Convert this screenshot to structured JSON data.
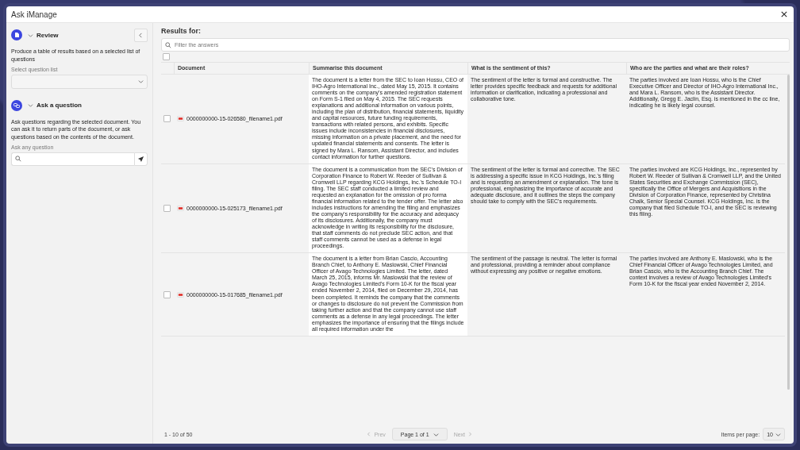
{
  "window": {
    "title": "Ask iManage"
  },
  "sidebar": {
    "sections": [
      {
        "kind": "review",
        "title": "Review",
        "expanded": true,
        "description": "Produce a table of results based on a selected list of questions",
        "field_label": "Select question list"
      },
      {
        "kind": "ask",
        "title": "Ask a question",
        "expanded": true,
        "description": "Ask questions regarding the selected document. You can ask it to return parts of the document, or ask questions based on the contents of the document.",
        "field_label": "Ask any question"
      }
    ]
  },
  "results": {
    "heading": "Results for:",
    "filter": {
      "placeholder": "Filter the answers"
    },
    "select_all": {
      "checked": false
    },
    "columns": [
      "Document",
      "Summarise this document",
      "What is the sentiment of this?",
      "Who are the parties and what are their roles?"
    ],
    "rows": [
      {
        "checked": false,
        "cells": [
          "0000000000-15-026580_filename1.pdf",
          "The document is a letter from the SEC to Ioan Hossu, CEO of IHO-Agro International Inc., dated May 15, 2015. It contains comments on the company's amended registration statement on Form S-1 filed on May 4, 2015. The SEC requests explanations and additional information on various points, including the plan of distribution, financial statements, liquidity and capital resources, future funding requirements, transactions with related persons, and exhibits. Specific issues include inconsistencies in financial disclosures, missing information on a private placement, and the need for updated financial statements and consents. The letter is signed by Mara L. Ransom, Assistant Director, and includes contact information for further questions.",
          "The sentiment of the letter is formal and constructive. The letter provides specific feedback and requests for additional information or clarification, indicating a professional and collaborative tone.",
          "The parties involved are Ioan Hossu, who is the Chief Executive Officer and Director of IHO-Agro International Inc., and Mara L. Ransom, who is the Assistant Director. Additionally, Gregg E. Jaclin, Esq. is mentioned in the cc line, indicating he is likely legal counsel."
        ]
      },
      {
        "checked": false,
        "cells": [
          "0000000000-15-025173_filename1.pdf",
          "The document is a communication from the SEC's Division of Corporation Finance to Robert W. Reeder of Sullivan & Cromwell LLP regarding KCG Holdings, Inc.'s Schedule TO-I filing. The SEC staff conducted a limited review and requested an explanation for the omission of pro forma financial information related to the tender offer. The letter also includes instructions for amending the filing and emphasizes the company's responsibility for the accuracy and adequacy of its disclosures. Additionally, the company must acknowledge in writing its responsibility for the disclosure, that staff comments do not preclude SEC action, and that staff comments cannot be used as a defense in legal proceedings.",
          "The sentiment of the letter is formal and corrective. The SEC is addressing a specific issue in KCG Holdings, Inc.'s filing and is requesting an amendment or explanation. The tone is professional, emphasizing the importance of accurate and adequate disclosure, and it outlines the steps the company should take to comply with the SEC's requirements.",
          "The parties involved are KCG Holdings, Inc., represented by Robert W. Reeder of Sullivan & Cromwell LLP, and the United States Securities and Exchange Commission (SEC), specifically the Office of Mergers and Acquisitions in the Division of Corporation Finance, represented by Christina Chalk, Senior Special Counsel. KCG Holdings, Inc. is the company that filed Schedule TO-I, and the SEC is reviewing this filing."
        ]
      },
      {
        "checked": false,
        "cells": [
          "0000000000-15-017685_filename1.pdf",
          "The document is a letter from Brian Cascio, Accounting Branch Chief, to Anthony E. Maslowski, Chief Financial Officer of Avago Technologies Limited. The letter, dated March 25, 2015, informs Mr. Maslowski that the review of Avago Technologies Limited's Form 10-K for the fiscal year ended November 2, 2014, filed on December 29, 2014, has been completed. It reminds the company that the comments or changes to disclosure do not prevent the Commission from taking further action and that the company cannot use staff comments as a defense in any legal proceedings. The letter emphasizes the importance of ensuring that the filings include all required information under the",
          "The sentiment of the passage is neutral. The letter is formal and professional, providing a reminder about compliance without expressing any positive or negative emotions.",
          "The parties involved are Anthony E. Maslowski, who is the Chief Financial Officer of Avago Technologies Limited, and Brian Cascio, who is the Accounting Branch Chief. The context involves a review of Avago Technologies Limited's Form 10-K for the fiscal year ended November 2, 2014."
        ]
      }
    ],
    "footer": {
      "range": "1 - 10 of 50",
      "prev": "Prev",
      "page": "Page 1 of 1",
      "next": "Next",
      "items_label": "Items per page:",
      "items_value": "10"
    }
  }
}
